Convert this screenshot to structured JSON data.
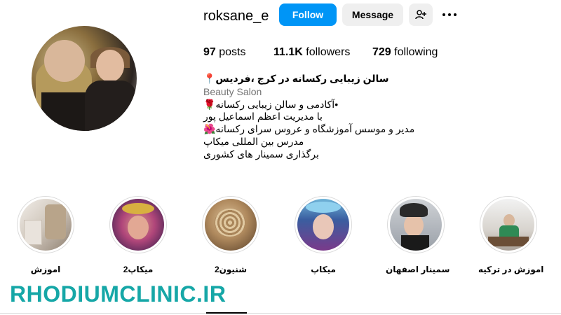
{
  "profile": {
    "username": "roksane_e",
    "follow_label": "Follow",
    "message_label": "Message",
    "add_user_icon": "add-user-icon",
    "more_icon": "more-icon",
    "accent_color": "#0095f6"
  },
  "stats": {
    "posts_count": "97",
    "posts_label": "posts",
    "followers_count": "11.1K",
    "followers_label": "followers",
    "following_count": "729",
    "following_label": "following"
  },
  "bio": {
    "name": "سالن زیبایی رکسانه در کرج ،فردیس📍",
    "category": "Beauty Salon",
    "lines": [
      "•آکادمی و سالن زیبایی رکسانه🌹",
      "با مدیریت اعظم اسماعیل پور",
      "مدیر و موسس آموزشگاه و عروس سرای رکسانه🌺",
      "مدرس بین المللی میکاپ",
      "برگذاری سمینار های کشوری"
    ]
  },
  "highlights": [
    {
      "label": "اموزش"
    },
    {
      "label": "میکاپ2"
    },
    {
      "label": "شنیون2"
    },
    {
      "label": "میکاپ"
    },
    {
      "label": "سمینار اصفهان"
    },
    {
      "label": "اموزش در ترکیه"
    }
  ],
  "watermark": "RHODIUMCLINIC.IR"
}
